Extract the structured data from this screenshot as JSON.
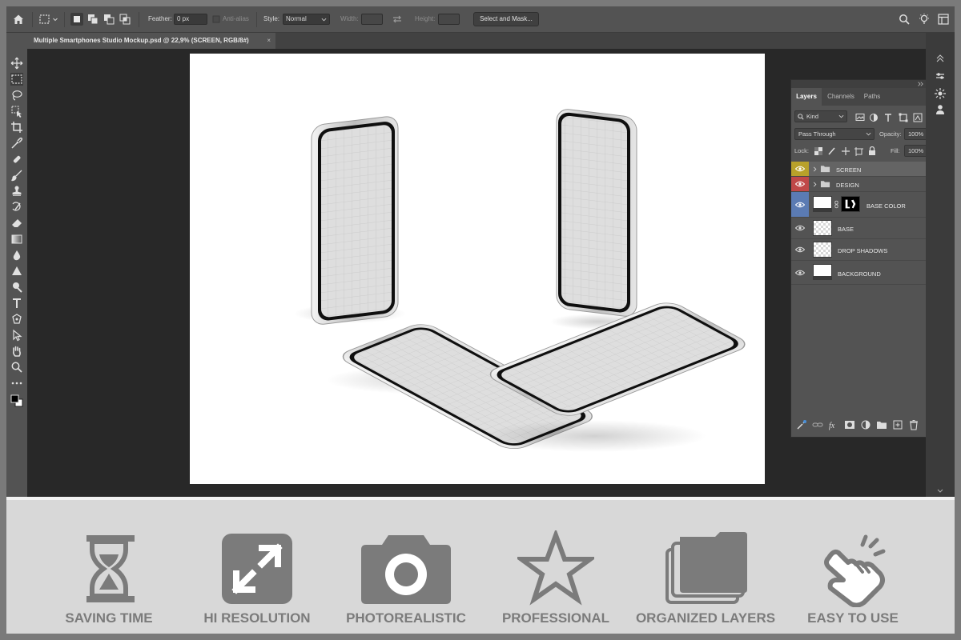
{
  "options_bar": {
    "feather_label": "Feather:",
    "feather_value": "0 px",
    "antialias_label": "Anti-alias",
    "style_label": "Style:",
    "style_value": "Normal",
    "width_label": "Width:",
    "height_label": "Height:",
    "select_mask_label": "Select and Mask..."
  },
  "document": {
    "tab_title": "Multiple Smartphones Studio Mockup.psd @ 22,9% (SCREEN, RGB/8#)",
    "close_glyph": "×"
  },
  "layers_panel": {
    "tabs": [
      "Layers",
      "Channels",
      "Paths"
    ],
    "active_tab": "Layers",
    "filter_kind": "Kind",
    "blend_mode": "Pass Through",
    "opacity_label": "Opacity:",
    "opacity_value": "100%",
    "lock_label": "Lock:",
    "fill_label": "Fill:",
    "fill_value": "100%",
    "layers": [
      {
        "name": "SCREEN",
        "type": "group",
        "eye_color": "#b8a12a",
        "selected": true
      },
      {
        "name": "DESIGN",
        "type": "group",
        "eye_color": "#c04848",
        "selected": false
      },
      {
        "name": "BASE COLOR",
        "type": "layer-mask",
        "eye_color": "#5b7bb3",
        "selected": false
      },
      {
        "name": "BASE",
        "type": "transparent",
        "eye_color": "",
        "selected": false
      },
      {
        "name": "DROP SHADOWS",
        "type": "transparent",
        "eye_color": "",
        "selected": false
      },
      {
        "name": "BACKGROUND",
        "type": "white",
        "eye_color": "",
        "selected": false
      }
    ]
  },
  "features": [
    {
      "label": "SAVING TIME",
      "icon": "hourglass-icon"
    },
    {
      "label": "HI RESOLUTION",
      "icon": "expand-arrows-icon"
    },
    {
      "label": "PHOTOREALISTIC",
      "icon": "camera-icon"
    },
    {
      "label": "PROFESSIONAL",
      "icon": "star-icon"
    },
    {
      "label": "ORGANIZED LAYERS",
      "icon": "stacked-folders-icon"
    },
    {
      "label": "EASY TO USE",
      "icon": "pointing-hand-icon"
    }
  ],
  "colors": {
    "app_bg": "#535353",
    "workspace_bg": "#282828",
    "banner_bg": "#d8d8d8",
    "feature_gray": "#7b7b7b"
  }
}
